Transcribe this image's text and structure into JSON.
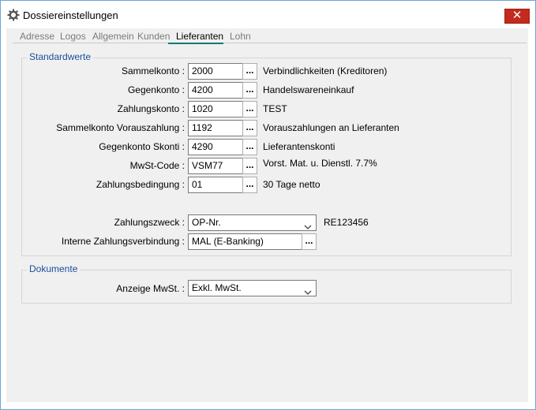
{
  "window": {
    "title": "Dossiereinstellungen",
    "close_symbol": "✕"
  },
  "tabs": [
    "Adresse",
    "Logos",
    "Allgemein",
    "Kunden",
    "Lieferanten",
    "Lohn"
  ],
  "active_tab": "Lieferanten",
  "standardwerte": {
    "title": "Standardwerte",
    "rows": [
      {
        "label": "Sammelkonto :",
        "value": "2000",
        "desc": "Verbindlichkeiten (Kreditoren)"
      },
      {
        "label": "Gegenkonto :",
        "value": "4200",
        "desc": "Handelswareneinkauf"
      },
      {
        "label": "Zahlungskonto :",
        "value": "1020",
        "desc": "TEST"
      },
      {
        "label": "Sammelkonto Vorauszahlung :",
        "value": "1192",
        "desc": "Vorauszahlungen an Lieferanten"
      },
      {
        "label": "Gegenkonto Skonti :",
        "value": "4290",
        "desc": "Lieferantenskonti"
      },
      {
        "label": "MwSt-Code :",
        "value": "VSM77",
        "desc": "Vorst. Mat. u. Dienstl. 7.7%"
      },
      {
        "label": "Zahlungsbedingung :",
        "value": "01",
        "desc": "30 Tage netto"
      }
    ],
    "zahlungszweck": {
      "label": "Zahlungszweck :",
      "value": "OP-Nr.",
      "ref": "RE123456"
    },
    "zahlungsverbindung": {
      "label": "Interne Zahlungsverbindung :",
      "value": "MAL (E-Banking)"
    },
    "browse_label": "..."
  },
  "dokumente": {
    "title": "Dokumente",
    "anzeige": {
      "label": "Anzeige MwSt. :",
      "value": "Exkl. MwSt."
    }
  }
}
